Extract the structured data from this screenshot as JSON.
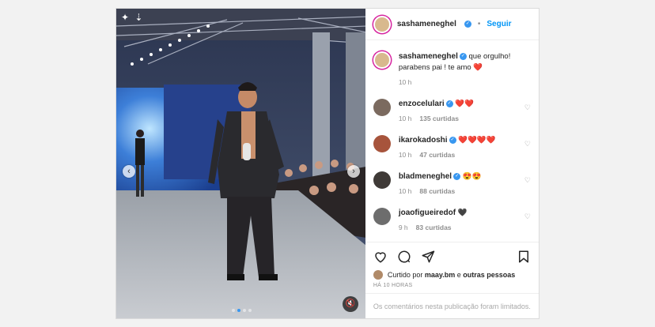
{
  "post": {
    "author": "sashameneghel",
    "follow_label": "Seguir",
    "separator": "•",
    "caption": {
      "author": "sashameneghel",
      "text_line1": "que orgulho!",
      "text_line2": "parabens pai ! te amo",
      "emoji": "❤️",
      "time": "10 h"
    },
    "comments": [
      {
        "user": "enzocelulari",
        "text": "❤️❤️",
        "time": "10 h",
        "likes": "135 curtidas"
      },
      {
        "user": "ikarokadoshi",
        "text": "❤️❤️❤️❤️",
        "time": "10 h",
        "likes": "47 curtidas"
      },
      {
        "user": "bladmeneghel",
        "text": "😍😍",
        "time": "10 h",
        "likes": "88 curtidas"
      },
      {
        "user": "joaofigueiredof",
        "text": "🖤",
        "time": "9 h",
        "likes": "83 curtidas"
      }
    ],
    "liked_by": {
      "prefix": "Curtido por",
      "user": "maay.bm",
      "suffix": "e",
      "others": "outras pessoas"
    },
    "posted_ago": "HÁ 10 HORAS",
    "comments_limited": "Os comentários nesta publicação foram limitados."
  },
  "media": {
    "prev_glyph": "‹",
    "next_glyph": "›",
    "mute_glyph": "🔇",
    "slide_count": 4,
    "active_slide": 2
  },
  "colors": {
    "accent": "#0095f6",
    "verified": "#3897f0",
    "heart": "#ed4956"
  }
}
